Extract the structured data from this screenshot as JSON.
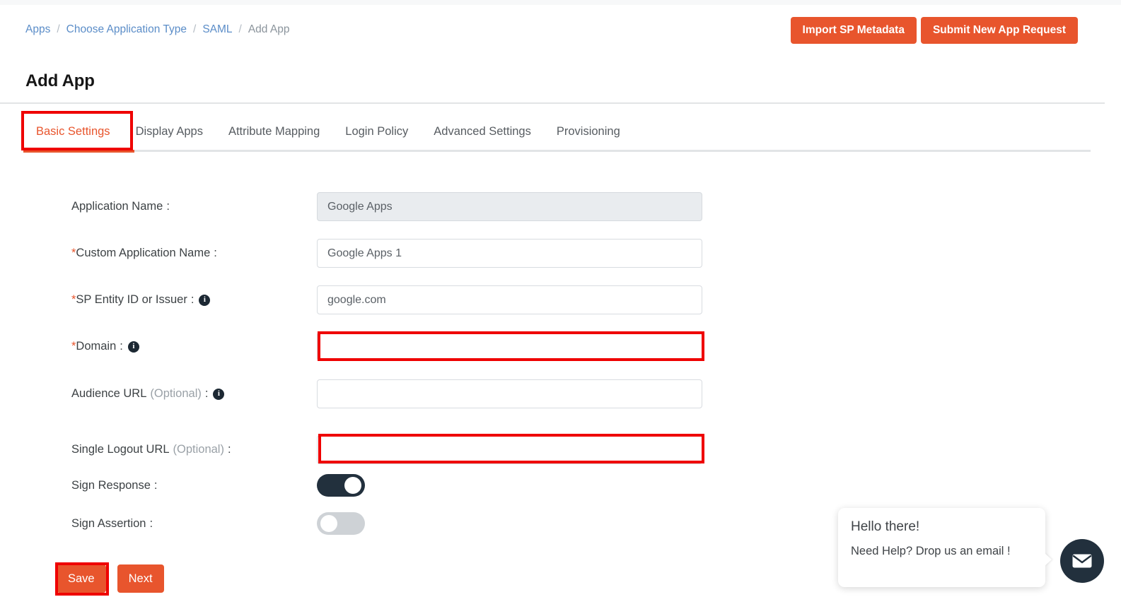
{
  "breadcrumb": {
    "items": [
      {
        "label": "Apps",
        "link": true
      },
      {
        "label": "Choose Application Type",
        "link": true
      },
      {
        "label": "SAML",
        "link": true
      },
      {
        "label": "Add App",
        "link": false
      }
    ],
    "separator": "/"
  },
  "header": {
    "title": "Add App",
    "import_button": "Import SP Metadata",
    "submit_button": "Submit New App Request"
  },
  "tabs": [
    {
      "label": "Basic Settings",
      "active": true
    },
    {
      "label": "Display Apps",
      "active": false
    },
    {
      "label": "Attribute Mapping",
      "active": false
    },
    {
      "label": "Login Policy",
      "active": false
    },
    {
      "label": "Advanced Settings",
      "active": false
    },
    {
      "label": "Provisioning",
      "active": false
    }
  ],
  "form": {
    "application_name": {
      "label": "Application Name",
      "value": "Google Apps",
      "placeholder": "",
      "required": false,
      "disabled": true,
      "info": false
    },
    "custom_application_name": {
      "label": "Custom Application Name",
      "value": "Google Apps 1",
      "placeholder": "",
      "required": true,
      "disabled": false,
      "info": false
    },
    "sp_entity_id": {
      "label": "SP Entity ID or Issuer",
      "value": "google.com",
      "placeholder": "",
      "required": true,
      "disabled": false,
      "info": true
    },
    "domain": {
      "label": "Domain",
      "value": "",
      "placeholder": "",
      "required": true,
      "disabled": false,
      "info": true,
      "highlighted": true
    },
    "audience_url": {
      "label": "Audience URL",
      "optional": "(Optional)",
      "value": "",
      "placeholder": "",
      "required": false,
      "disabled": false,
      "info": true
    },
    "single_logout_url": {
      "label": "Single Logout URL",
      "optional": "(Optional)",
      "value": "",
      "placeholder": "",
      "required": false,
      "disabled": false,
      "info": false,
      "highlighted": true
    },
    "sign_response": {
      "label": "Sign Response",
      "state": "on"
    },
    "sign_assertion": {
      "label": "Sign Assertion",
      "state": "off"
    }
  },
  "footer": {
    "save_label": "Save",
    "next_label": "Next"
  },
  "chat": {
    "greeting": "Hello there!",
    "message": "Need Help? Drop us an email !",
    "icon": "envelope-icon"
  },
  "colors": {
    "accent_orange": "#e8552d",
    "annotation_red": "#ef0000",
    "toggle_on": "#22303d",
    "toggle_off": "#ced2d6",
    "link_blue": "#5b8dc8",
    "disabled_bg": "#e9ecef"
  }
}
